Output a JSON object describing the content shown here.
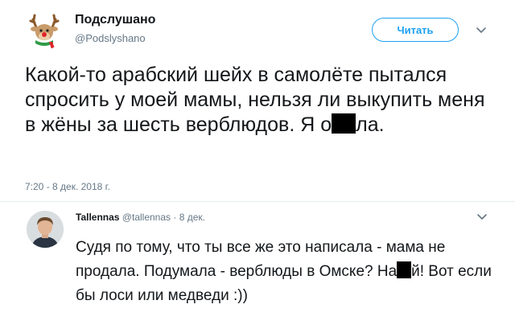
{
  "tweet": {
    "author_name": "Подслушано",
    "author_handle": "@Podslyshano",
    "follow_label": "Читать",
    "text_part1": "Какой-то арабский шейх в самолёте пытался спросить у моей мамы, нельзя ли выкупить меня в жёны за шесть верблюдов. Я о",
    "text_part2": "ла.",
    "timestamp": "7:20 - 8 дек. 2018 г."
  },
  "reply": {
    "author_name": "Tallennas",
    "author_handle": "@tallennas",
    "date": "· 8 дек.",
    "text_part1": "Судя по тому, что ты все же это написала - мама не продала. Подумала - верблюды в Омске? На",
    "text_part2": "й! Вот если бы лоси или медведи :))"
  },
  "icons": {
    "author_avatar": "reindeer-avatar-icon",
    "caret": "chevron-down-icon"
  },
  "colors": {
    "accent": "#1da1f2",
    "secondary_text": "#657786",
    "divider": "#e6ecf0"
  }
}
